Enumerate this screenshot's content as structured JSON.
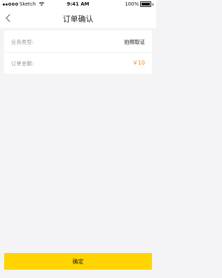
{
  "status_bar": {
    "carrier": "Sketch",
    "time": "9:41 AM",
    "battery": "100%",
    "battery_level": 1.0,
    "icons": {
      "signal": "signal-dots-icon",
      "wifi": "wifi-icon",
      "battery": "battery-icon"
    }
  },
  "nav": {
    "title": "订单确认",
    "back_icon": "back-arrow-icon"
  },
  "order": {
    "rows": [
      {
        "label": "业务类型:",
        "value": "拍照取证"
      },
      {
        "label": "订单金额:",
        "value": "￥10"
      }
    ]
  },
  "colors": {
    "accent_yellow": "#ffd400",
    "price_orange": "#f08a1c",
    "background": "#f4f4f6"
  },
  "actions": {
    "confirm_label": "确定"
  }
}
